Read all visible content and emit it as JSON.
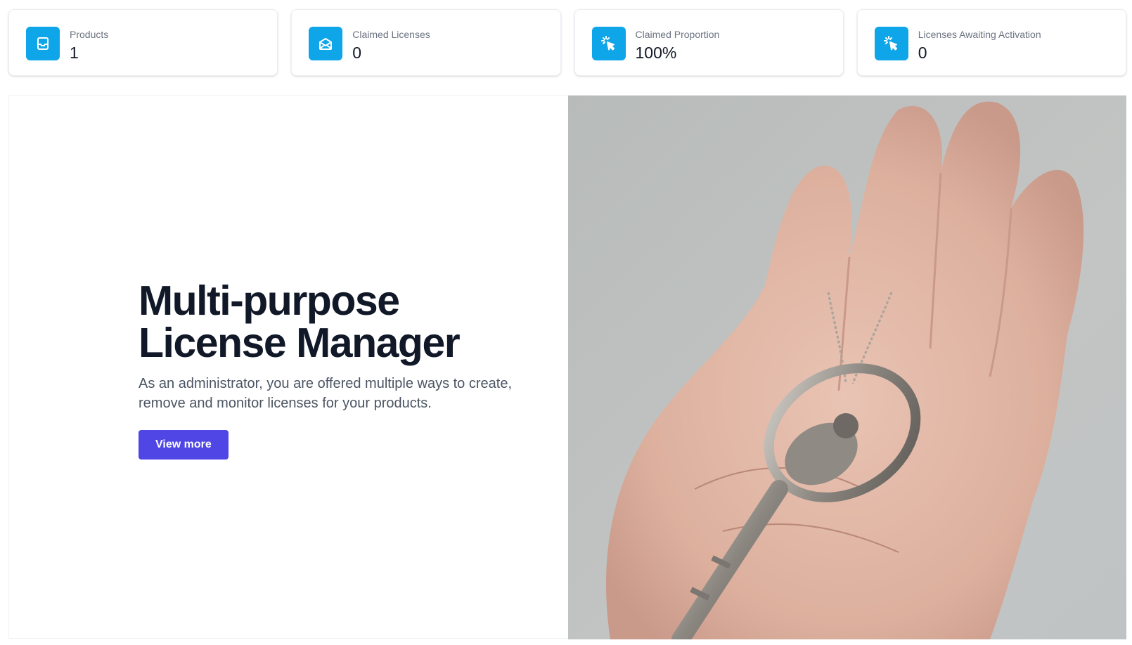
{
  "stats": [
    {
      "label": "Products",
      "value": "1",
      "icon": "inbox-icon"
    },
    {
      "label": "Claimed Licenses",
      "value": "0",
      "icon": "envelope-open-icon"
    },
    {
      "label": "Claimed Proportion",
      "value": "100%",
      "icon": "cursor-click-icon"
    },
    {
      "label": "Licenses Awaiting Activation",
      "value": "0",
      "icon": "cursor-click-icon"
    }
  ],
  "hero": {
    "title_line1": "Multi-purpose",
    "title_line2": "License Manager",
    "description": "As an administrator, you are offered multiple ways to create, remove and monitor licenses for your products.",
    "button_label": "View more",
    "image": "hand-holding-key-photo"
  },
  "colors": {
    "icon_bg": "#0ea5e9",
    "button_bg": "#4f46e5",
    "title": "#111827",
    "muted": "#6b7280"
  }
}
